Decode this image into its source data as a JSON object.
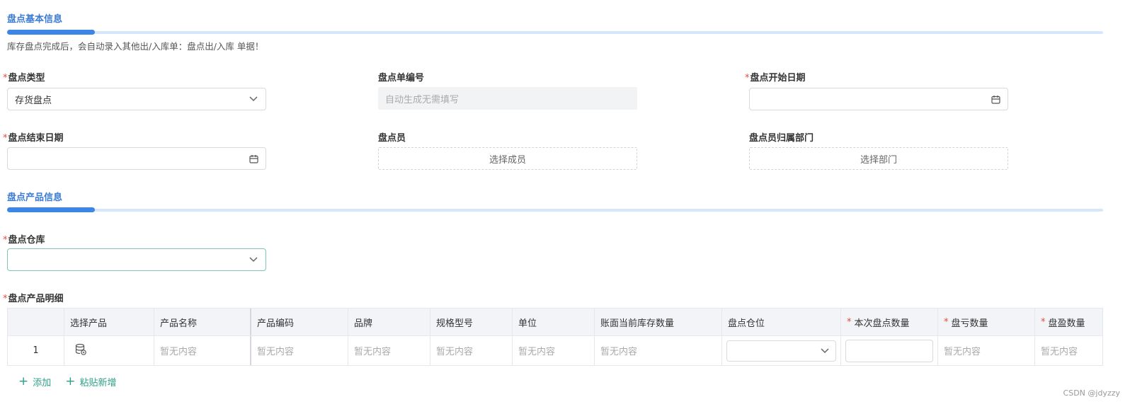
{
  "basic": {
    "title": "盘点基本信息",
    "notice": "库存盘点完成后，会自动录入其他出/入库单：盘点出/入库 单据！",
    "type_label": "盘点类型",
    "type_value": "存货盘点",
    "code_label": "盘点单编号",
    "code_placeholder": "自动生成无需填写",
    "start_label": "盘点开始日期",
    "end_label": "盘点结束日期",
    "member_label": "盘点员",
    "member_button": "选择成员",
    "dept_label": "盘点员归属部门",
    "dept_button": "选择部门"
  },
  "product": {
    "title": "盘点产品信息",
    "warehouse_label": "盘点仓库",
    "detail_label": "盘点产品明细"
  },
  "table": {
    "columns": [
      "",
      "选择产品",
      "产品名称",
      "产品编码",
      "品牌",
      "规格型号",
      "单位",
      "账面当前库存数量",
      "盘点仓位",
      "本次盘点数量",
      "盘亏数量",
      "盘盈数量"
    ],
    "row": {
      "index": "1",
      "empty": "暂无内容"
    }
  },
  "actions": {
    "add": "添加",
    "paste": "粘贴新增"
  },
  "watermark": "CSDN @jdyzzy",
  "colors": {
    "accent": "#3c86e8",
    "required": "#e74c3c",
    "action": "#2f9e88"
  }
}
